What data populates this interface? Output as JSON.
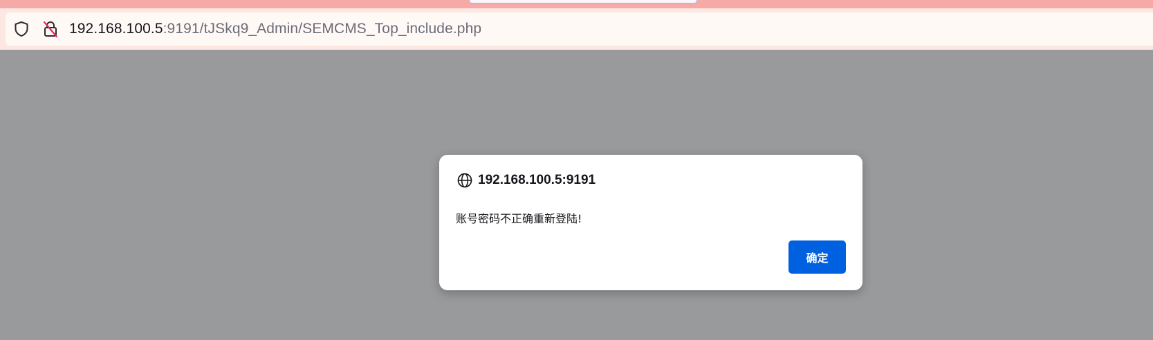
{
  "address_bar": {
    "url_host": "192.168.100.5",
    "url_rest": ":9191/tJSkq9_Admin/SEMCMS_Top_include.php",
    "icons": [
      "shield-icon",
      "insecure-lock-icon"
    ]
  },
  "dialog": {
    "origin": "192.168.100.5:9191",
    "origin_icon": "globe-icon",
    "message": "账号密码不正确重新登陆!",
    "ok_label": "确定"
  },
  "colors": {
    "overlay": "#999a9c",
    "top_strip": "#f6aaa8",
    "toolbar": "#fde7e1",
    "button": "#0061e0"
  }
}
